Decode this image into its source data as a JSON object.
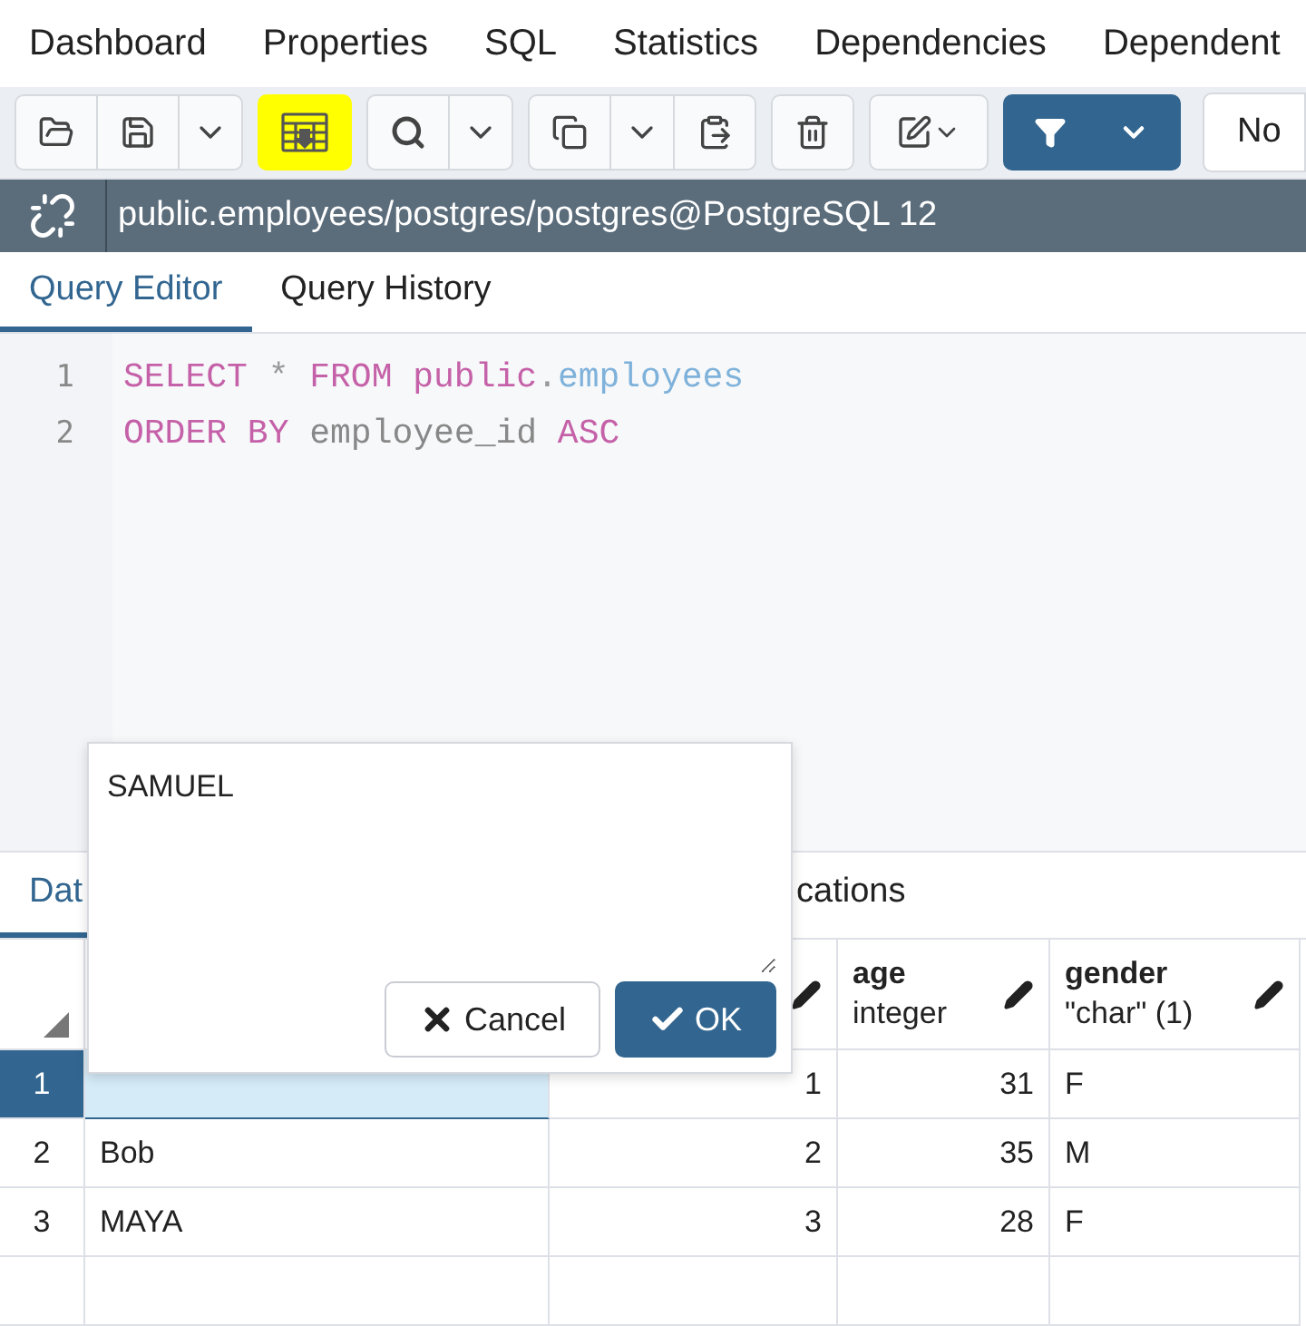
{
  "top_tabs": [
    {
      "label": "Dashboard"
    },
    {
      "label": "Properties"
    },
    {
      "label": "SQL"
    },
    {
      "label": "Statistics"
    },
    {
      "label": "Dependencies"
    },
    {
      "label": "Dependent"
    }
  ],
  "toolbar": {
    "groups": [
      [
        {
          "kind": "open",
          "highlighted": false
        },
        {
          "kind": "save",
          "highlighted": false
        },
        {
          "kind": "caret",
          "highlighted": false
        }
      ],
      [
        {
          "kind": "download",
          "highlighted": true
        }
      ],
      [
        {
          "kind": "search",
          "highlighted": false
        },
        {
          "kind": "caret",
          "highlighted": false
        }
      ],
      [
        {
          "kind": "copy",
          "highlighted": false
        },
        {
          "kind": "caret",
          "highlighted": false
        },
        {
          "kind": "paste",
          "highlighted": false
        }
      ],
      [
        {
          "kind": "delete",
          "highlighted": false
        }
      ],
      [
        {
          "kind": "edit",
          "highlighted": false
        }
      ],
      [
        {
          "kind": "filter",
          "highlighted": false
        }
      ]
    ],
    "select_value": "No"
  },
  "connection": "public.employees/postgres/postgres@PostgreSQL 12",
  "editor_tabs": [
    {
      "label": "Query Editor",
      "selected": true
    },
    {
      "label": "Query History",
      "selected": false
    }
  ],
  "editor": {
    "lines": [
      {
        "number": "1",
        "tokens": [
          {
            "kind": "keyword",
            "text": "SELECT"
          },
          {
            "kind": "operator",
            "text": "*"
          },
          {
            "kind": "keyword",
            "text": "FROM"
          },
          {
            "kind": "keyword",
            "text": "public"
          },
          {
            "kind": "dot",
            "text": "."
          },
          {
            "kind": "table",
            "text": "employees"
          }
        ]
      },
      {
        "number": "2",
        "tokens": [
          {
            "kind": "keyword",
            "text": "ORDER BY"
          },
          {
            "kind": "identifier",
            "text": "employee_id"
          },
          {
            "kind": "keyword",
            "text": "ASC"
          }
        ]
      }
    ]
  },
  "result_tabs": [
    {
      "label": "Dat",
      "selected": true
    },
    {
      "label": "cations",
      "selected": false
    }
  ],
  "grid": {
    "columns": [
      {
        "kind": "covered",
        "numeric": false
      },
      {
        "kind": "partly_covered",
        "numeric": true
      },
      {
        "kind": "named",
        "name": "age",
        "type": "integer",
        "numeric": true
      },
      {
        "kind": "named",
        "name": "gender",
        "type": "\"char\" (1)",
        "numeric": false
      }
    ],
    "rows": [
      {
        "number": "1",
        "selected": true,
        "cells": [
          null,
          "1",
          "31",
          "F"
        ]
      },
      {
        "number": "2",
        "selected": false,
        "cells": [
          "Bob",
          "2",
          "35",
          "M"
        ]
      },
      {
        "number": "3",
        "selected": false,
        "cells": [
          "MAYA",
          "3",
          "28",
          "F"
        ]
      }
    ]
  },
  "popup": {
    "value": "SAMUEL",
    "buttons": [
      {
        "kind": "cancel",
        "label": "Cancel"
      },
      {
        "kind": "ok",
        "label": "OK"
      }
    ]
  }
}
